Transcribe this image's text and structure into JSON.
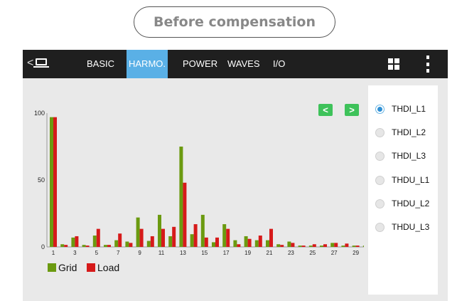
{
  "caption": "Before compensation",
  "toolbar": {
    "back_glyph": "<",
    "tabs": [
      {
        "label": "BASIC",
        "active": false
      },
      {
        "label": "HARMO.",
        "active": true
      },
      {
        "label": "POWER",
        "active": false
      },
      {
        "label": "WAVES",
        "active": false
      },
      {
        "label": "I/O",
        "active": false
      }
    ],
    "icons": [
      "laptop-icon",
      "grid-view-icon",
      "more-vert-icon"
    ]
  },
  "nav": {
    "prev": "<",
    "next": ">"
  },
  "options": [
    {
      "label": "THDI_L1",
      "checked": true
    },
    {
      "label": "THDI_L2",
      "checked": false
    },
    {
      "label": "THDI_L3",
      "checked": false
    },
    {
      "label": "THDU_L1",
      "checked": false
    },
    {
      "label": "THDU_L2",
      "checked": false
    },
    {
      "label": "THDU_L3",
      "checked": false
    }
  ],
  "colors": {
    "grid": "#6b9a10",
    "load": "#d61a1a",
    "active_tab": "#5ab0e6",
    "nav": "#3ec25a"
  },
  "chart_data": {
    "type": "bar",
    "categories": [
      "1",
      "2",
      "3",
      "4",
      "5",
      "6",
      "7",
      "8",
      "9",
      "10",
      "11",
      "12",
      "13",
      "14",
      "15",
      "16",
      "17",
      "18",
      "19",
      "20",
      "21",
      "22",
      "23",
      "24",
      "25",
      "26",
      "27",
      "28",
      "29",
      "30"
    ],
    "x_tick_labels": [
      "1",
      "3",
      "5",
      "7",
      "9",
      "11",
      "13",
      "15",
      "17",
      "19",
      "21",
      "23",
      "25",
      "27",
      "29"
    ],
    "y_tick_labels": [
      "0",
      "50",
      "100"
    ],
    "ylim": [
      0,
      100
    ],
    "series": [
      {
        "name": "Grid",
        "values": [
          97,
          2,
          7,
          1.5,
          8.5,
          1.5,
          5,
          4,
          22,
          4.5,
          24,
          8,
          75,
          9.5,
          24,
          3.5,
          17,
          5,
          8,
          5,
          5,
          2,
          4,
          1,
          1,
          1,
          3,
          1,
          1,
          1
        ]
      },
      {
        "name": "Load",
        "values": [
          97,
          1.5,
          8,
          1,
          13.5,
          1.5,
          10,
          3,
          13.5,
          8,
          13.5,
          15,
          48,
          17,
          7,
          7,
          13.5,
          2,
          6,
          8.5,
          13.5,
          1.5,
          3,
          1,
          2,
          2,
          3,
          2.5,
          1,
          1
        ]
      }
    ],
    "legend": "bottom-left"
  }
}
